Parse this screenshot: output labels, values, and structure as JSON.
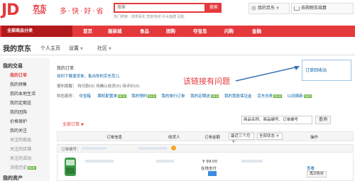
{
  "header": {
    "logo_text": "JD",
    "logo_cn": "京东",
    "logo_com": ".COM",
    "slogan": "多·快·好·省",
    "search_placeholder": "搜索",
    "search_button": "搜索",
    "hot_words": "热门搜索：搞笑耳机  智能电视  补水面膜  冠能",
    "user_label": "我的京东",
    "cart_label": "去购物车结算"
  },
  "nav": {
    "category": "全部商品分类",
    "items": [
      "首页",
      "服装城",
      "食品",
      "团购",
      "夺宝岛",
      "闪购",
      "金融"
    ]
  },
  "subnav": {
    "title": "我的京东",
    "items": [
      "个人主页",
      "设置",
      "社区"
    ]
  },
  "sidebar": {
    "sections": [
      {
        "head": "我的交易",
        "items": [
          "我的订单",
          "我的预售",
          "我的本地生活",
          "我的定期送",
          "我的团购",
          "价格保护",
          "我的关注",
          "关注的商品",
          "关注的店铺",
          "关注的活动",
          "浏览历史"
        ]
      },
      {
        "head": "我的资产",
        "items": []
      }
    ]
  },
  "main": {
    "orders_title": "我的订单",
    "orders_info": "如何下载退货单，售出你的京东范儿",
    "reminders": "便利提醒：  待付款(0)   待确认收货(0)   待评价(0)",
    "features_label": "特色服务：",
    "features": [
      "夺宝箱",
      "票机配置单",
      "我的预约",
      "我的旅行订单",
      "我的定期送",
      "我的宽段保证金",
      "京东白条",
      "以旧换新"
    ],
    "bad_link": "订单回收站",
    "annotation": "该链接有问题",
    "recent_filter": "全部订单",
    "search_placeholder": "商品名称、商品编号、订单编号",
    "search_button": "查询",
    "table_headers": [
      "订单信息",
      "收货人",
      "订单金额",
      "操作"
    ],
    "time_filter": "最近三个月",
    "status_filter": "全部状态",
    "order_no_label": "订单编号：",
    "price": "¥ 99.00",
    "pay_type": "在线支付",
    "action_link": "查看",
    "buy_again": "再次购买"
  }
}
